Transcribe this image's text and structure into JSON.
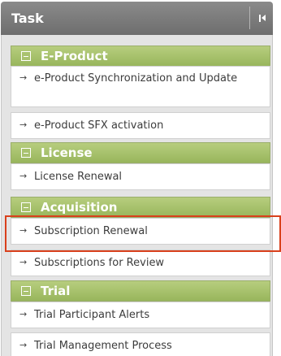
{
  "task_panel": {
    "title": "Task",
    "categories": [
      {
        "label": "E-Product",
        "items": [
          "e-Product Synchronization and Update",
          "e-Product SFX activation"
        ]
      },
      {
        "label": "License",
        "items": [
          "License Renewal"
        ]
      },
      {
        "label": "Acquisition",
        "items": [
          "Subscription Renewal",
          "Subscriptions for Review"
        ]
      },
      {
        "label": "Trial",
        "items": [
          "Trial Participant Alerts",
          "Trial Management Process"
        ]
      }
    ]
  },
  "icons": {
    "collapse": "collapse-left-icon",
    "expander": "minus-box-icon",
    "bullet": "arrow-right-icon",
    "arrow_glyph": "→"
  },
  "colors": {
    "header_bg": "#7d7d7d",
    "category_bg": "#a9c26f",
    "highlight_border": "#d9401c"
  }
}
